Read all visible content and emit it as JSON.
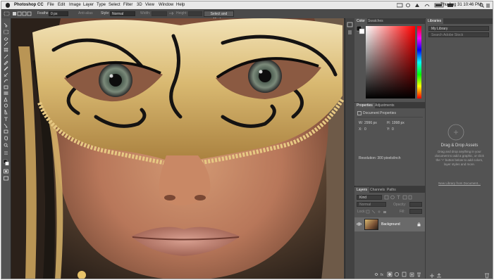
{
  "menubar": {
    "app_name": "Photoshop CC",
    "items": [
      "File",
      "Edit",
      "Image",
      "Layer",
      "Type",
      "Select",
      "Filter",
      "3D",
      "View",
      "Window",
      "Help"
    ],
    "clock": "Thu Aug 31 10:46 PM"
  },
  "options_bar": {
    "feather_label": "Feather:",
    "feather_value": "0 px",
    "anti_alias_label": "Anti-alias",
    "style_label": "Style:",
    "style_value": "Normal",
    "width_label": "Width:",
    "height_label": "Height:",
    "select_mask_label": "Select and Mask..."
  },
  "color_panel": {
    "tabs": [
      "Color",
      "Swatches"
    ]
  },
  "properties_panel": {
    "tabs": [
      "Properties",
      "Adjustments"
    ],
    "heading": "Document Properties",
    "w_label": "W:",
    "w_value": "2996 px",
    "h_label": "H:",
    "h_value": "1998 px",
    "x_label": "X:",
    "x_value": "0",
    "y_label": "Y:",
    "y_value": "0",
    "resolution": "Resolution: 300 pixels/inch"
  },
  "layers_panel": {
    "tabs": [
      "Layers",
      "Channels",
      "Paths"
    ],
    "kind_label": "Kind",
    "blend_mode": "Normal",
    "opacity_label": "Opacity:",
    "lock_label": "Lock:",
    "fill_label": "Fill:",
    "layer_name": "Background"
  },
  "libraries_panel": {
    "tab": "Libraries",
    "library_select": "My Library",
    "search_placeholder": "Search Adobe Stock",
    "empty_title": "Drag & Drop Assets",
    "empty_text": "Drag and drop anything in your document to add a graphic, or click the '+' button below to add colors, layer styles and more.",
    "link": "New Library from Document..."
  },
  "colors": {
    "panel_bg": "#535353",
    "canvas_bg": "#6b5038",
    "accent": "#4c8fd6"
  }
}
